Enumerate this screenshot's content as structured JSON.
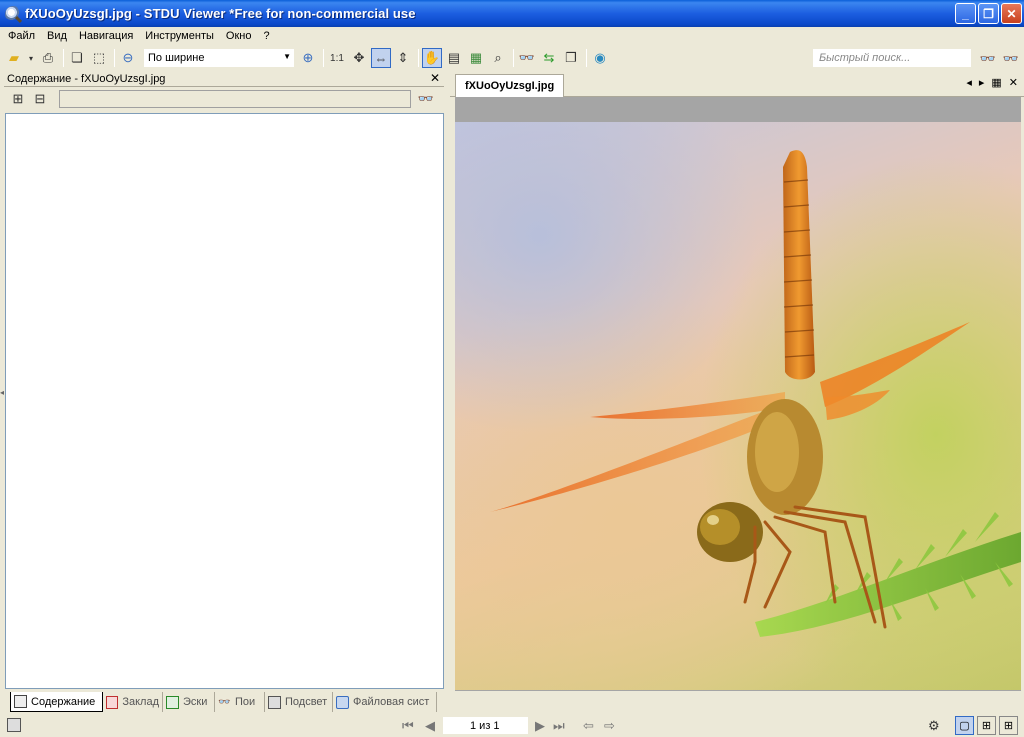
{
  "window": {
    "title": "fXUoOyUzsgI.jpg - STDU Viewer *Free for non-commercial use",
    "min_icon": "minimize-icon",
    "max_icon": "maximize-icon",
    "close_icon": "close-icon"
  },
  "menu": {
    "items": [
      {
        "label": "Файл"
      },
      {
        "label": "Вид"
      },
      {
        "label": "Навигация"
      },
      {
        "label": "Инструменты"
      },
      {
        "label": "Окно"
      },
      {
        "label": "?"
      }
    ]
  },
  "toolbar": {
    "zoom_mode": "По ширине",
    "actual_size": "1:1",
    "quick_search_placeholder": "Быстрый поиск..."
  },
  "left_panel": {
    "title": "Содержание - fXUoOyUzsgI.jpg",
    "tabs": [
      {
        "label": "Содержание",
        "icon": "contents-icon",
        "active": true
      },
      {
        "label": "Заклад",
        "icon": "bookmark-icon"
      },
      {
        "label": "Эски",
        "icon": "thumbnails-icon"
      },
      {
        "label": "Пои",
        "icon": "search-icon"
      },
      {
        "label": "Подсвет",
        "icon": "highlight-icon"
      },
      {
        "label": "Файловая сист",
        "icon": "filesystem-icon"
      }
    ]
  },
  "document": {
    "tab_label": "fXUoOyUzsgI.jpg",
    "image_subject": "dragonfly-photo"
  },
  "status": {
    "page_indicator": "1 из 1"
  },
  "colors": {
    "titlebar": "#0b49c9",
    "chrome": "#ece9d8",
    "selection": "#c1d2ee"
  }
}
